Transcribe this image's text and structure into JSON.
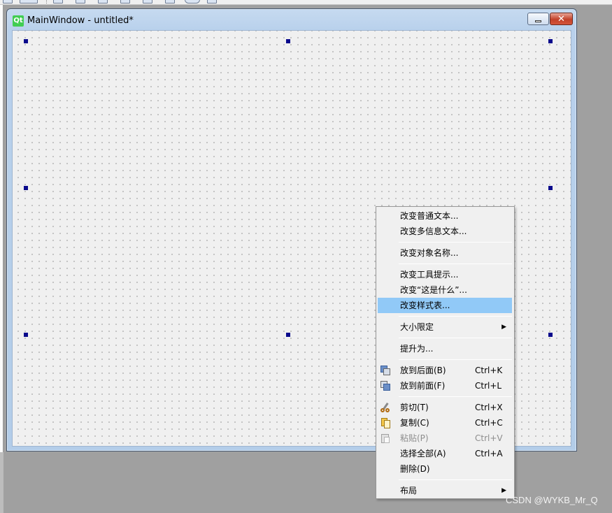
{
  "window": {
    "title": "MainWindow - untitled*",
    "logo_text": "Qt",
    "close_glyph": "✕"
  },
  "context_menu": {
    "groups": [
      [
        {
          "label": "改变普通文本..."
        },
        {
          "label": "改变多信息文本..."
        }
      ],
      [
        {
          "label": "改变对象名称..."
        }
      ],
      [
        {
          "label": "改变工具提示..."
        },
        {
          "label": "改变“这是什么”..."
        },
        {
          "label": "改变样式表...",
          "highlighted": true
        }
      ],
      [
        {
          "label": "大小限定",
          "submenu": true
        }
      ],
      [
        {
          "label": "提升为..."
        }
      ],
      [
        {
          "label": "放到后面(B)",
          "shortcut": "Ctrl+K",
          "icon": "send-to-back-icon"
        },
        {
          "label": "放到前面(F)",
          "shortcut": "Ctrl+L",
          "icon": "bring-to-front-icon"
        }
      ],
      [
        {
          "label": "剪切(T)",
          "shortcut": "Ctrl+X",
          "icon": "cut-icon"
        },
        {
          "label": "复制(C)",
          "shortcut": "Ctrl+C",
          "icon": "copy-icon"
        },
        {
          "label": "粘贴(P)",
          "shortcut": "Ctrl+V",
          "icon": "paste-icon",
          "disabled": true
        },
        {
          "label": "选择全部(A)",
          "shortcut": "Ctrl+A"
        },
        {
          "label": "删除(D)"
        }
      ],
      [
        {
          "label": "布局",
          "submenu": true
        }
      ]
    ]
  },
  "watermark": "CSDN @WYKB_Mr_Q",
  "colors": {
    "highlight": "#91c9f7",
    "selection_handle": "#0a0a8c",
    "disabled_text": "#8d8d8d"
  }
}
